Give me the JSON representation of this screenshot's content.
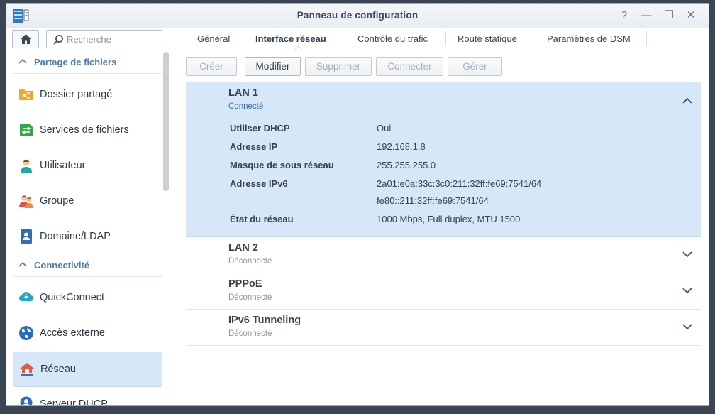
{
  "window": {
    "title": "Panneau de configuration"
  },
  "titlebar_buttons": [
    {
      "name": "help-button",
      "glyph": "?"
    },
    {
      "name": "minimize-button",
      "glyph": "—"
    },
    {
      "name": "maximize-button",
      "glyph": "❐"
    },
    {
      "name": "close-button",
      "glyph": "✕"
    }
  ],
  "sidebar": {
    "search_placeholder": "Recherche",
    "sections": [
      {
        "label": "Partage de fichiers"
      },
      {
        "label": "Connectivité"
      }
    ],
    "items": [
      {
        "label": "Dossier partagé",
        "icon": "shared-folder-icon"
      },
      {
        "label": "Services de fichiers",
        "icon": "file-services-icon"
      },
      {
        "label": "Utilisateur",
        "icon": "user-icon"
      },
      {
        "label": "Groupe",
        "icon": "group-icon"
      },
      {
        "label": "Domaine/LDAP",
        "icon": "domain-ldap-icon"
      },
      {
        "label": "QuickConnect",
        "icon": "quickconnect-icon"
      },
      {
        "label": "Accès externe",
        "icon": "external-access-icon"
      },
      {
        "label": "Réseau",
        "icon": "network-icon",
        "active": true
      },
      {
        "label": "Serveur DHCP",
        "icon": "dhcp-server-icon"
      }
    ]
  },
  "tabs": [
    {
      "label": "Général"
    },
    {
      "label": "Interface réseau",
      "active": true
    },
    {
      "label": "Contrôle du trafic"
    },
    {
      "label": "Route statique"
    },
    {
      "label": "Paramètres de DSM"
    }
  ],
  "toolbar": {
    "create": "Créer",
    "modify": "Modifier",
    "delete": "Supprimer",
    "connect": "Connecter",
    "manage": "Gérer"
  },
  "interfaces": [
    {
      "name": "LAN 1",
      "status": "Connecté",
      "expanded": true,
      "details": [
        {
          "label": "Utiliser DHCP",
          "value": "Oui"
        },
        {
          "label": "Adresse IP",
          "value": "192.168.1.8"
        },
        {
          "label": "Masque de sous réseau",
          "value": "255.255.255.0"
        },
        {
          "label": "Adresse IPv6",
          "value": "2a01:e0a:33c:3c0:211:32ff:fe69:7541/64",
          "value2": "fe80::211:32ff:fe69:7541/64"
        },
        {
          "label": "État du réseau",
          "value": "1000 Mbps, Full duplex, MTU 1500"
        }
      ]
    },
    {
      "name": "LAN 2",
      "status": "Déconnecté"
    },
    {
      "name": "PPPoE",
      "status": "Déconnecté"
    },
    {
      "name": "IPv6 Tunneling",
      "status": "Déconnecté"
    }
  ],
  "colors": {
    "accent_blue": "#3a76c4",
    "connected": "#2e6fbe",
    "disconnected": "#8a959f",
    "selected_bg": "#d6e7f8"
  }
}
